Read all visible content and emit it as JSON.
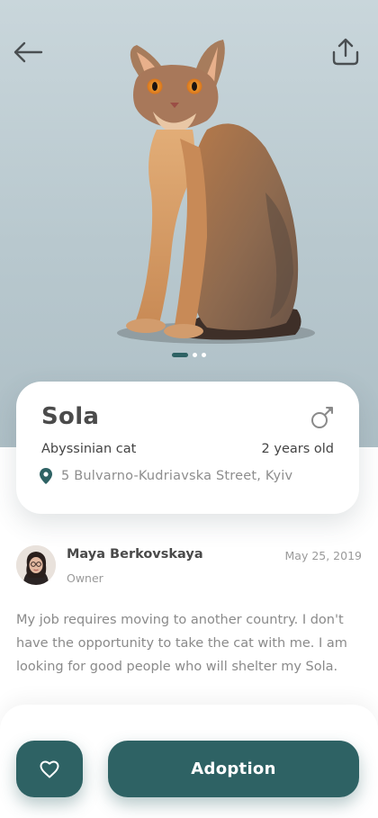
{
  "header": {
    "back_icon": "arrow-left-icon",
    "share_icon": "share-upload-icon"
  },
  "hero": {
    "image": "cat-photo",
    "carousel": {
      "count": 3,
      "active": 1
    }
  },
  "pet": {
    "name": "Sola",
    "gender_icon": "male-gender-icon",
    "breed": "Abyssinian cat",
    "age": "2 years old",
    "location_icon": "location-pin-icon",
    "location": "5 Bulvarno-Kudriavska Street, Kyiv"
  },
  "owner": {
    "name": "Maya Berkovskaya",
    "role": "Owner",
    "date": "May 25, 2019"
  },
  "description": "My job requires moving to another country. I don't have the opportunity to take the cat with me. I am looking for good people who will shelter my Sola.",
  "actions": {
    "favorite_icon": "heart-icon",
    "adopt_label": "Adoption"
  },
  "colors": {
    "accent": "#2e6264",
    "hero_background": "#c2d1d6",
    "card_background": "#ffffff"
  }
}
